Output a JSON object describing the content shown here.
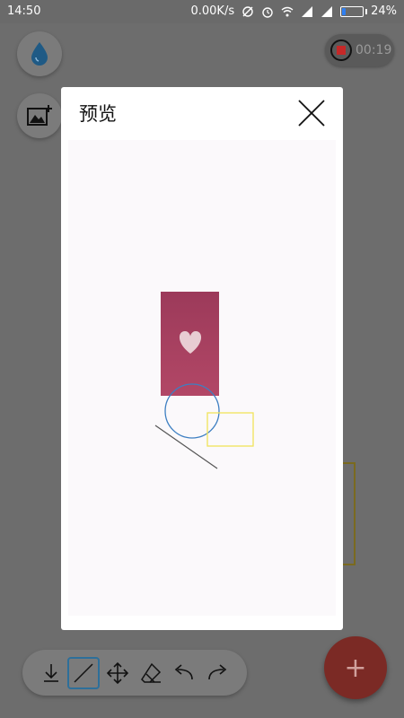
{
  "status_bar": {
    "time": "14:50",
    "network_speed": "0.00K/s",
    "battery_percent": "24%",
    "battery_level": 0.24
  },
  "toolbar_top": {
    "record_timer": "00:19"
  },
  "dialog": {
    "title": "预览"
  },
  "colors": {
    "accent_blue": "#2f7ff1",
    "record_red": "#c62828",
    "shape_circle": "#3d7fc2",
    "shape_rect": "#f1e35a",
    "fab": "#7b2a25"
  },
  "icons": {
    "drop": "water-drop-icon",
    "image": "add-image-icon",
    "close": "close-icon",
    "save": "download-icon",
    "line": "line-tool-icon",
    "move": "move-icon",
    "eraser": "eraser-icon",
    "undo": "undo-icon",
    "redo": "redo-icon",
    "add": "plus-icon"
  },
  "fab": {
    "label": "+"
  }
}
